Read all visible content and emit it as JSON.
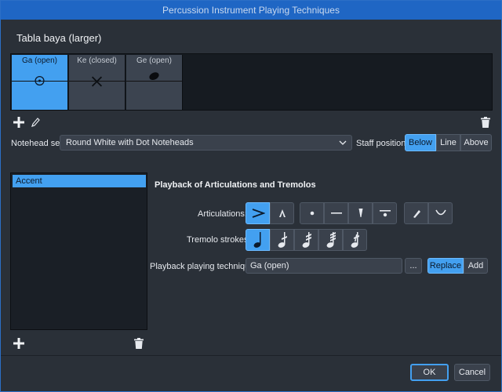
{
  "window": {
    "title": "Percussion Instrument Playing Techniques"
  },
  "instrument": {
    "name": "Tabla baya (larger)"
  },
  "techniques": [
    {
      "label": "Ga (open)",
      "icon": "circle-dot-notehead-icon",
      "selected": true
    },
    {
      "label": "Ke (closed)",
      "icon": "x-notehead-icon",
      "selected": false
    },
    {
      "label": "Ge (open)",
      "icon": "filled-notehead-icon",
      "selected": false
    }
  ],
  "technique_toolbar": {
    "add_icon": "plus-icon",
    "edit_icon": "pencil-icon",
    "delete_icon": "trash-icon"
  },
  "notehead": {
    "label": "Notehead set:",
    "value": "Round White with Dot Noteheads"
  },
  "staff_position": {
    "label": "Staff position:",
    "options": [
      "Below",
      "Line",
      "Above"
    ],
    "selected": "Below"
  },
  "articulation_list": {
    "items": [
      "Accent"
    ],
    "selected": "Accent"
  },
  "playback": {
    "title": "Playback of Articulations and Tremolos",
    "articulations_label": "Articulations:",
    "tremolo_label": "Tremolo strokes:",
    "technique_label": "Playback playing technique:",
    "technique_value": "Ga (open)",
    "browse_label": "...",
    "replace_label": "Replace",
    "add_label": "Add"
  },
  "dialog": {
    "ok_label": "OK",
    "cancel_label": "Cancel"
  },
  "colors": {
    "accent": "#43a0f0",
    "background": "#2a3038",
    "titlebar": "#1f66c4"
  }
}
